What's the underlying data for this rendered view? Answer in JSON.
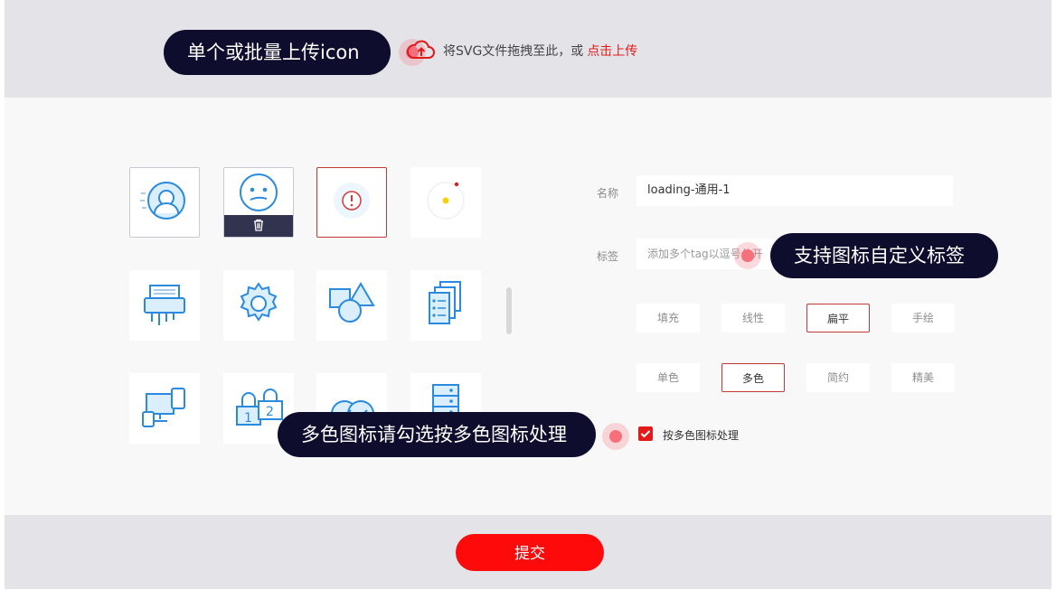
{
  "callouts": {
    "upload": "单个或批量上传icon",
    "tags": "支持图标自定义标签",
    "multicolor": "多色图标请勾选按多色图标处理"
  },
  "upload": {
    "hint": "将SVG文件拖拽至此，或",
    "link": "点击上传",
    "icon": "cloud-upload-icon"
  },
  "icons": [
    {
      "name": "user-avatar-icon",
      "state": "bordered"
    },
    {
      "name": "face-icon",
      "state": "hover-delete",
      "action_icon": "trash-icon"
    },
    {
      "name": "alert-icon",
      "state": "selected"
    },
    {
      "name": "loading-icon",
      "state": "normal"
    },
    {
      "name": "printer-icon",
      "state": "normal"
    },
    {
      "name": "gear-icon",
      "state": "normal"
    },
    {
      "name": "shapes-icon",
      "state": "normal"
    },
    {
      "name": "documents-icon",
      "state": "normal"
    },
    {
      "name": "devices-icon",
      "state": "normal"
    },
    {
      "name": "locks-icon",
      "state": "normal"
    },
    {
      "name": "checks-icon",
      "state": "normal"
    },
    {
      "name": "server-icon",
      "state": "normal"
    }
  ],
  "form": {
    "name_label": "名称",
    "name_value": "loading-通用-1",
    "tag_label": "标签",
    "tag_placeholder": "添加多个tag以逗号分开",
    "style_options": [
      {
        "label": "填充",
        "active": false
      },
      {
        "label": "线性",
        "active": false
      },
      {
        "label": "扁平",
        "active": true
      },
      {
        "label": "手绘",
        "active": false
      },
      {
        "label": "单色",
        "active": false
      },
      {
        "label": "多色",
        "active": true
      },
      {
        "label": "简约",
        "active": false
      },
      {
        "label": "精美",
        "active": false
      }
    ],
    "multicolor_checkbox_label": "按多色图标处理",
    "multicolor_checked": true
  },
  "submit_label": "提交",
  "colors": {
    "accent": "#ff0a0a",
    "callout_bg": "#0f0d2e",
    "icon_blue": "#2a8ae0",
    "bar_bg": "#e4e3e8"
  }
}
